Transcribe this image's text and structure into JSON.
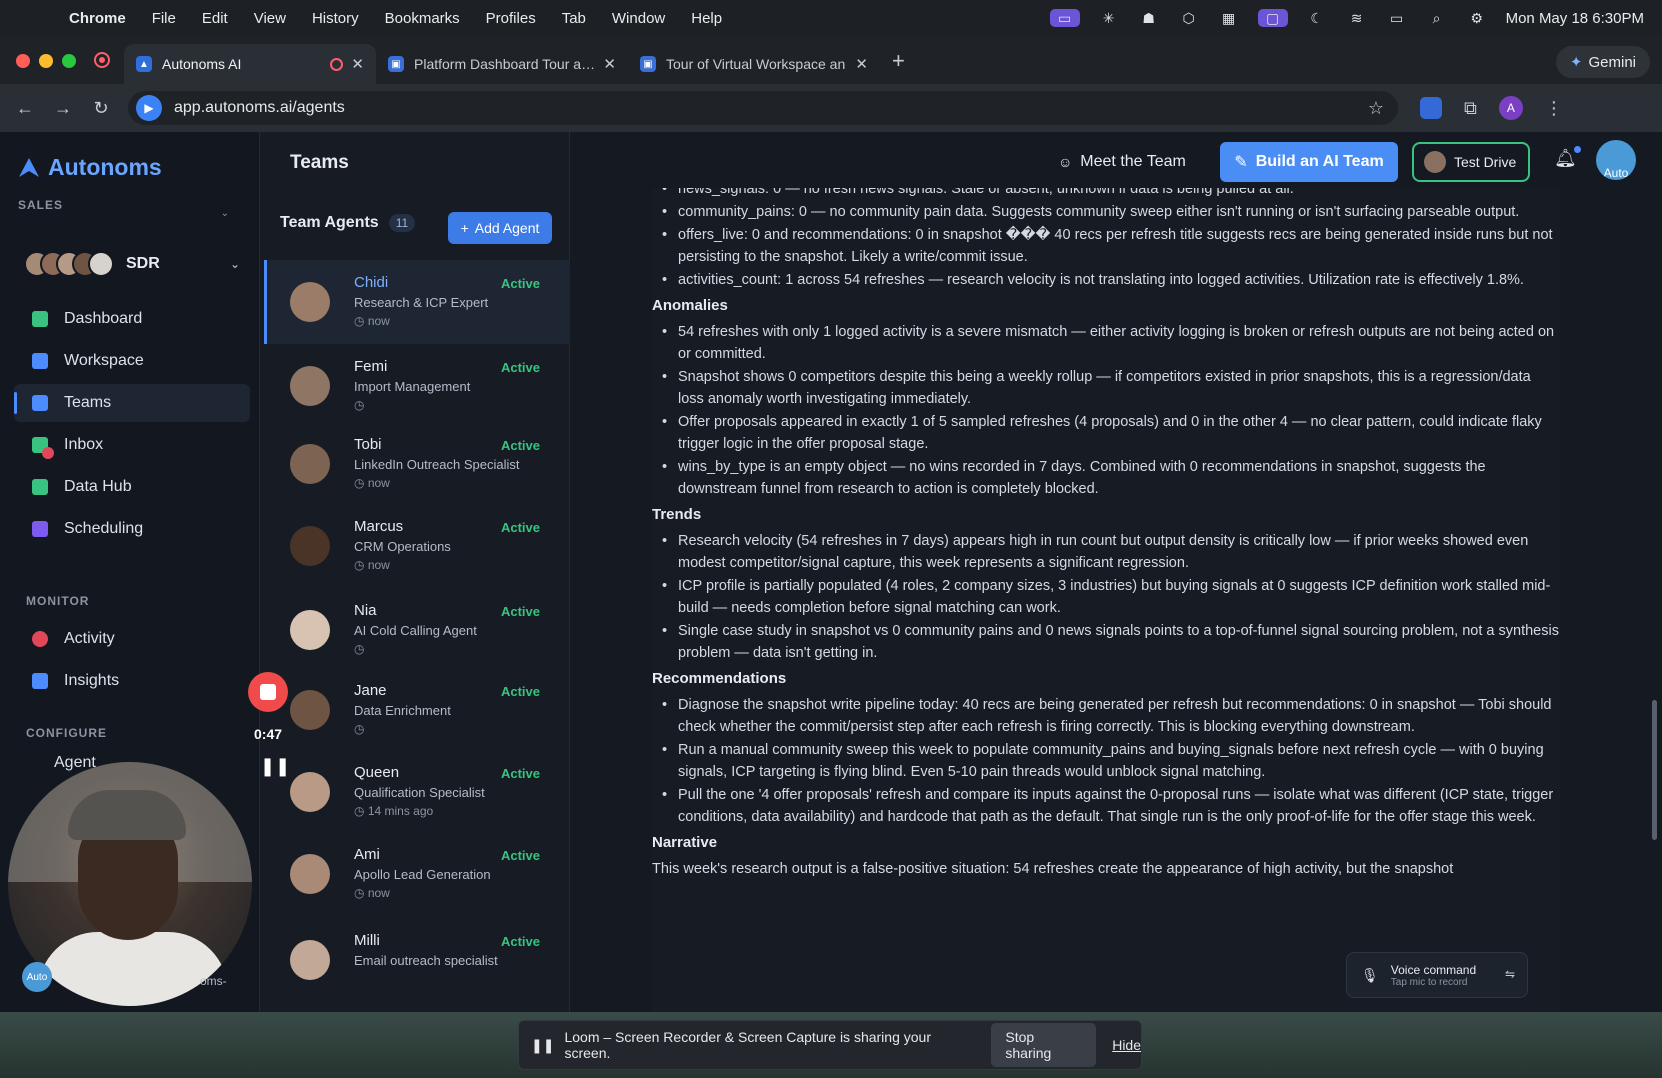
{
  "menubar": {
    "app": "Chrome",
    "items": [
      "File",
      "Edit",
      "View",
      "History",
      "Bookmarks",
      "Profiles",
      "Tab",
      "Window",
      "Help"
    ],
    "clock": "Mon May 18  6:30PM"
  },
  "browser": {
    "tabs": [
      {
        "label": "Autonoms AI",
        "active": true
      },
      {
        "label": "Platform Dashboard Tour and",
        "active": false
      },
      {
        "label": "Tour of Virtual Workspace an",
        "active": false
      }
    ],
    "url": "app.autonoms.ai/agents",
    "gemini": "Gemini",
    "profile_initial": "A"
  },
  "sidebar": {
    "logo": "Autonoms",
    "sales_label": "SALES",
    "team_name": "SDR",
    "nav": [
      {
        "label": "Dashboard",
        "color": "#38c480"
      },
      {
        "label": "Workspace",
        "color": "#4d8cff"
      },
      {
        "label": "Teams",
        "color": "#4d8cff"
      },
      {
        "label": "Inbox",
        "color": "#38c480"
      },
      {
        "label": "Data Hub",
        "color": "#38c480"
      },
      {
        "label": "Scheduling",
        "color": "#7c5cf0"
      }
    ],
    "monitor_label": "MONITOR",
    "monitor": [
      {
        "label": "Activity",
        "color": "#e0485a"
      },
      {
        "label": "Insights",
        "color": "#4d8cff"
      }
    ],
    "configure_label": "CONFIGURE",
    "configure_partial": "Agent",
    "bottom_text": "Auto",
    "bottom_text2": "oms-"
  },
  "teams": {
    "title": "Teams",
    "agents_label": "Team Agents",
    "agents_count": "11",
    "add_agent": "Add Agent",
    "agents": [
      {
        "name": "Chidi",
        "role": "Research & ICP Expert",
        "time": "now",
        "status": "Active",
        "selected": true
      },
      {
        "name": "Femi",
        "role": "Import Management",
        "time": "",
        "status": "Active"
      },
      {
        "name": "Tobi",
        "role": "LinkedIn Outreach Specialist",
        "time": "now",
        "status": "Active"
      },
      {
        "name": "Marcus",
        "role": "CRM Operations",
        "time": "now",
        "status": "Active"
      },
      {
        "name": "Nia",
        "role": "AI Cold Calling Agent",
        "time": "",
        "status": "Active"
      },
      {
        "name": "Jane",
        "role": "Data Enrichment",
        "time": "",
        "status": "Active"
      },
      {
        "name": "Queen",
        "role": "Qualification Specialist",
        "time": "14 mins ago",
        "status": "Active"
      },
      {
        "name": "Ami",
        "role": "Apollo Lead Generation",
        "time": "now",
        "status": "Active"
      },
      {
        "name": "Milli",
        "role": "Email outreach specialist",
        "time": "",
        "status": "Active"
      }
    ]
  },
  "header": {
    "meet": "Meet the Team",
    "build": "Build an AI Team",
    "test_drive": "Test Drive",
    "avatar_text": "Auto"
  },
  "report": {
    "top_bullets": [
      "news_signals: 0 — no fresh news signals. Stale or absent; unknown if data is being pulled at all.",
      "community_pains: 0 — no community pain data. Suggests community sweep either isn't running or isn't surfacing parseable output.",
      "offers_live: 0 and recommendations: 0 in snapshot ��� 40 recs per refresh title suggests recs are being generated inside runs but not persisting to the snapshot. Likely a write/commit issue.",
      "activities_count: 1 across 54 refreshes — research velocity is not translating into logged activities. Utilization rate is effectively 1.8%."
    ],
    "anomalies_title": "Anomalies",
    "anomalies": [
      "54 refreshes with only 1 logged activity is a severe mismatch — either activity logging is broken or refresh outputs are not being acted on or committed.",
      "Snapshot shows 0 competitors despite this being a weekly rollup — if competitors existed in prior snapshots, this is a regression/data loss anomaly worth investigating immediately.",
      "Offer proposals appeared in exactly 1 of 5 sampled refreshes (4 proposals) and 0 in the other 4 — no clear pattern, could indicate flaky trigger logic in the offer proposal stage.",
      "wins_by_type is an empty object — no wins recorded in 7 days. Combined with 0 recommendations in snapshot, suggests the downstream funnel from research to action is completely blocked."
    ],
    "trends_title": "Trends",
    "trends": [
      "Research velocity (54 refreshes in 7 days) appears high in run count but output density is critically low — if prior weeks showed even modest competitor/signal capture, this week represents a significant regression.",
      "ICP profile is partially populated (4 roles, 2 company sizes, 3 industries) but buying signals at 0 suggests ICP definition work stalled mid-build — needs completion before signal matching can work.",
      "Single case study in snapshot vs 0 community pains and 0 news signals points to a top-of-funnel signal sourcing problem, not a synthesis problem — data isn't getting in."
    ],
    "recs_title": "Recommendations",
    "recs": [
      "Diagnose the snapshot write pipeline today: 40 recs are being generated per refresh but recommendations: 0 in snapshot — Tobi should check whether the commit/persist step after each refresh is firing correctly. This is blocking everything downstream.",
      "Run a manual community sweep this week to populate community_pains and buying_signals before next refresh cycle — with 0 buying signals, ICP targeting is flying blind. Even 5-10 pain threads would unblock signal matching.",
      "Pull the one '4 offer proposals' refresh and compare its inputs against the 0-proposal runs — isolate what was different (ICP state, trigger conditions, data availability) and hardcode that path as the default. That single run is the only proof-of-life for the offer stage this week."
    ],
    "narrative_title": "Narrative",
    "narrative": "This week's research output is a false-positive situation: 54 refreshes create the appearance of high activity, but the snapshot"
  },
  "recorder": {
    "time": "0:47"
  },
  "voice": {
    "title": "Voice command",
    "sub": "Tap mic to record"
  },
  "loom": {
    "message": "Loom – Screen Recorder & Screen Capture is sharing your screen.",
    "stop": "Stop sharing",
    "hide": "Hide"
  }
}
